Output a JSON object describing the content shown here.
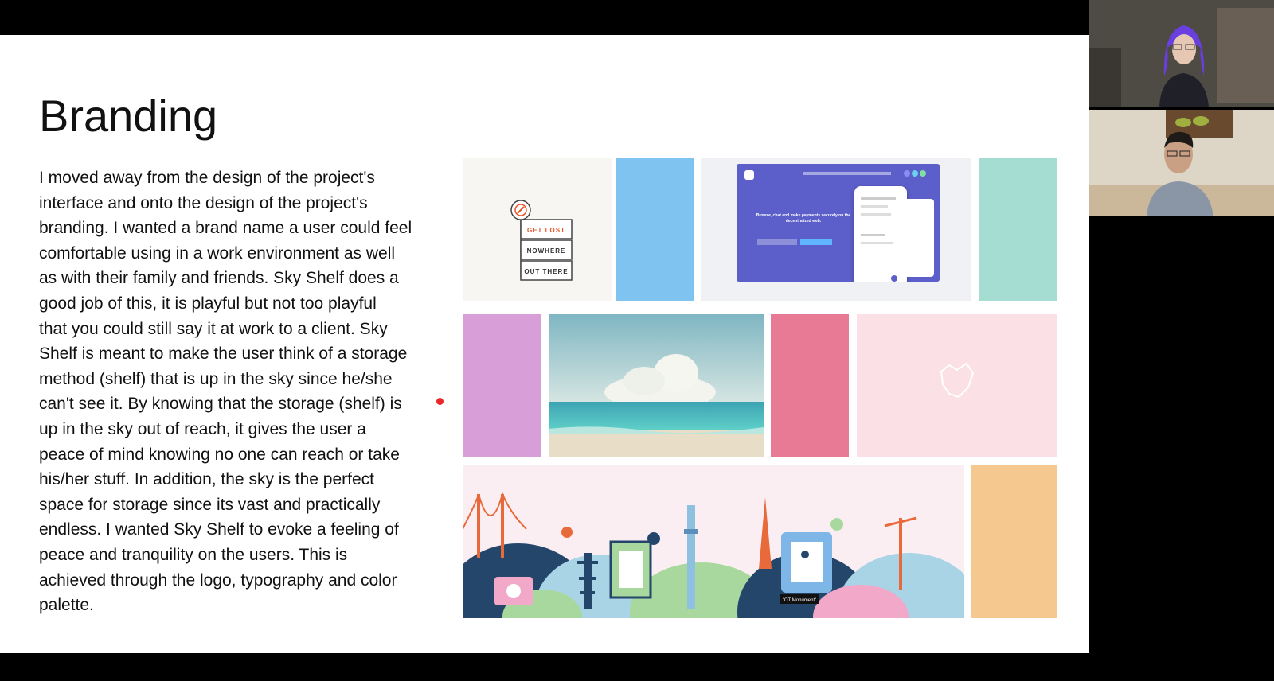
{
  "slide": {
    "title": "Branding",
    "paragraph_lines": [
      "I moved away from the design of the project's",
      "interface and onto the design of the project's",
      "branding. I wanted a brand name a user could feel",
      "comfortable using in a work environment as well",
      "as with their family and friends. Sky Shelf does a",
      "good job of this, it is playful but not too playful",
      "that you could still say it at work to a client. Sky",
      "Shelf is meant to make the user think of a storage",
      "method (shelf) that is up in the sky since he/she",
      "can't see it.  By knowing that the storage (shelf) is",
      "up in the sky out of reach, it gives the user a",
      "peace of mind knowing no one can reach or take",
      "his/her stuff. In addition, the sky is the perfect",
      "space for storage since its vast and practically",
      "endless. I wanted Sky Shelf to evoke a feeling of",
      "peace and tranquility on the users. This is",
      "achieved through the logo, typography and color",
      "palette."
    ],
    "signpost": [
      "GET LOST",
      "NOWHERE",
      "OUT THERE"
    ],
    "mockup_text": "Browse, chat and make payments securely on the decentralized web.",
    "city_tag": "\"OT Monument\"",
    "swatches": {
      "blue": "#7fc4f1",
      "teal": "#a5ddd3",
      "purple": "#d79ed8",
      "pink": "#e97a96",
      "light_pink": "#fbe0e5",
      "orange": "#f4c88e"
    }
  },
  "video": {
    "participant_1": "participant-video-1",
    "participant_2": "participant-video-2"
  }
}
